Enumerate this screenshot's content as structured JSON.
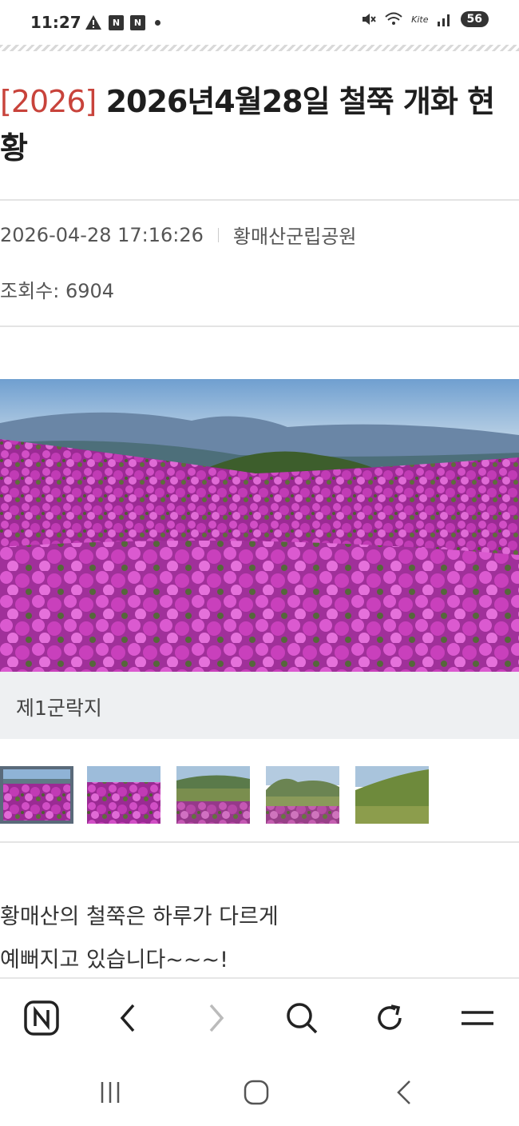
{
  "status_bar": {
    "time": "11:27",
    "left_icons": [
      "warning-icon",
      "notification-n-icon",
      "notification-n-icon",
      "dot-icon"
    ],
    "right_icons": [
      "mute-icon",
      "wifi-icon",
      "signal-icon"
    ],
    "network_label": "Kite",
    "battery": "56"
  },
  "article": {
    "tag": "[2026]",
    "title": " 2026년4월28일 철쭉 개화 현황",
    "date": "2026-04-28 17:16:26",
    "author": "황매산군립공원",
    "views_label": "조회수:",
    "views_value": "6904"
  },
  "photo": {
    "caption": "제1군락지",
    "thumbnail_count": 5,
    "active_thumbnail": 1
  },
  "body": {
    "line1": "황매산의 철쭉은 하루가 다르게",
    "line2": "예뻐지고  있습니다~~~!"
  },
  "toolbar": {
    "items": [
      "naver-home-icon",
      "back-icon",
      "forward-icon",
      "search-icon",
      "refresh-icon",
      "menu-icon"
    ]
  },
  "system_nav": {
    "items": [
      "recent-apps-icon",
      "home-icon",
      "back-icon"
    ]
  },
  "colors": {
    "tag_red": "#c8433b",
    "azalea_magenta": "#b02aa6",
    "caption_bg": "#eef0f2"
  }
}
